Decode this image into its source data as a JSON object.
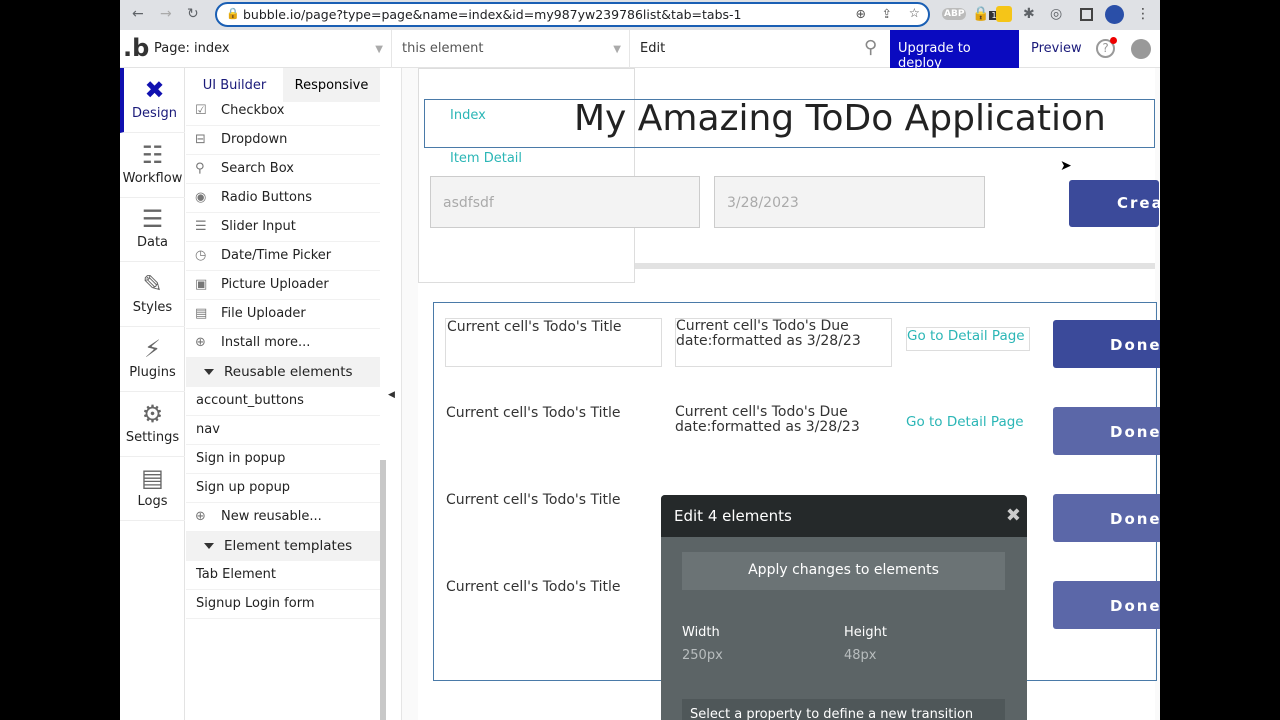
{
  "browser": {
    "url_host": "bubble.io",
    "url_path": "/page?type=page&name=index&id=my987yw239786list&tab=tabs-1",
    "ext_badge": "1",
    "ext_abp": "ABP"
  },
  "topbar": {
    "page_select": "Page: index",
    "element_select": "this element",
    "edit": "Edit",
    "upgrade": "Upgrade to deploy",
    "preview": "Preview"
  },
  "nav": [
    {
      "label": "Design",
      "icon": "design-icon"
    },
    {
      "label": "Workflow",
      "icon": "workflow-icon"
    },
    {
      "label": "Data",
      "icon": "database-icon"
    },
    {
      "label": "Styles",
      "icon": "brush-icon"
    },
    {
      "label": "Plugins",
      "icon": "plugin-icon"
    },
    {
      "label": "Settings",
      "icon": "gear-icon"
    },
    {
      "label": "Logs",
      "icon": "logs-icon"
    }
  ],
  "panel": {
    "tabs": [
      "UI Builder",
      "Responsive"
    ],
    "inputs": [
      "Checkbox",
      "Dropdown",
      "Search Box",
      "Radio Buttons",
      "Slider Input",
      "Date/Time Picker",
      "Picture Uploader",
      "File Uploader",
      "Install more..."
    ],
    "reusable_header": "Reusable elements",
    "reusable": [
      "account_buttons",
      "nav",
      "Sign in popup",
      "Sign up popup",
      "New reusable..."
    ],
    "templates_header": "Element templates",
    "templates": [
      "Tab Element",
      "Signup Login form"
    ]
  },
  "canvas": {
    "title": "My Amazing ToDo Application",
    "link_index": "Index",
    "link_detail": "Item Detail",
    "input_text": "asdfsdf",
    "input_date": "3/28/2023",
    "create_btn": "Crea",
    "rows": [
      {
        "title": "Current cell's Todo's Title",
        "due": "Current cell's Todo's Due date:formatted as 3/28/23",
        "link": "Go to Detail Page",
        "btn": "Done"
      },
      {
        "title": "Current cell's Todo's Title",
        "due": "Current cell's Todo's Due date:formatted as 3/28/23",
        "link": "Go to Detail Page",
        "btn": "Done"
      },
      {
        "title": "Current cell's Todo's Title",
        "btn": "Done"
      },
      {
        "title": "Current cell's Todo's Title",
        "btn": "Done"
      }
    ]
  },
  "popup": {
    "title": "Edit 4 elements",
    "apply": "Apply changes to elements",
    "width_label": "Width",
    "width_value": "250px",
    "height_label": "Height",
    "height_value": "48px",
    "transition_placeholder": "Select a property to define a new transition"
  },
  "colors": {
    "accent": "#0a0ac0",
    "link": "#2bb6b6",
    "done_active": "#3b4a9a",
    "done": "#5b67a8"
  }
}
